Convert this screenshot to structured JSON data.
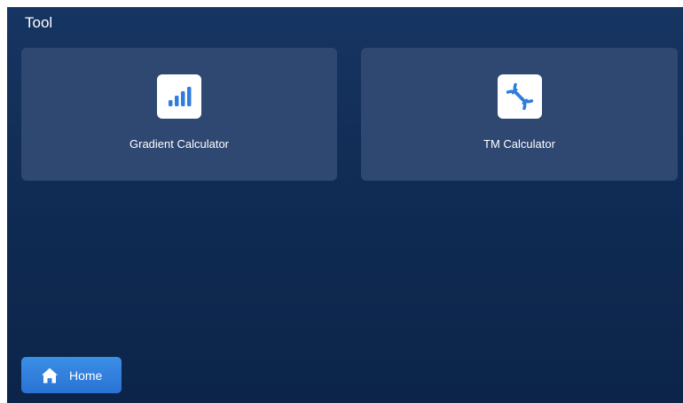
{
  "header": {
    "title": "Tool"
  },
  "cards": [
    {
      "label": "Gradient Calculator",
      "icon": "bar-chart-icon"
    },
    {
      "label": "TM Calculator",
      "icon": "dna-icon"
    }
  ],
  "footer": {
    "home_label": "Home",
    "home_icon": "home-icon"
  },
  "colors": {
    "background": "#0f2a52",
    "card": "#2e4872",
    "accent": "#2f7ddc",
    "text": "#ffffff"
  }
}
